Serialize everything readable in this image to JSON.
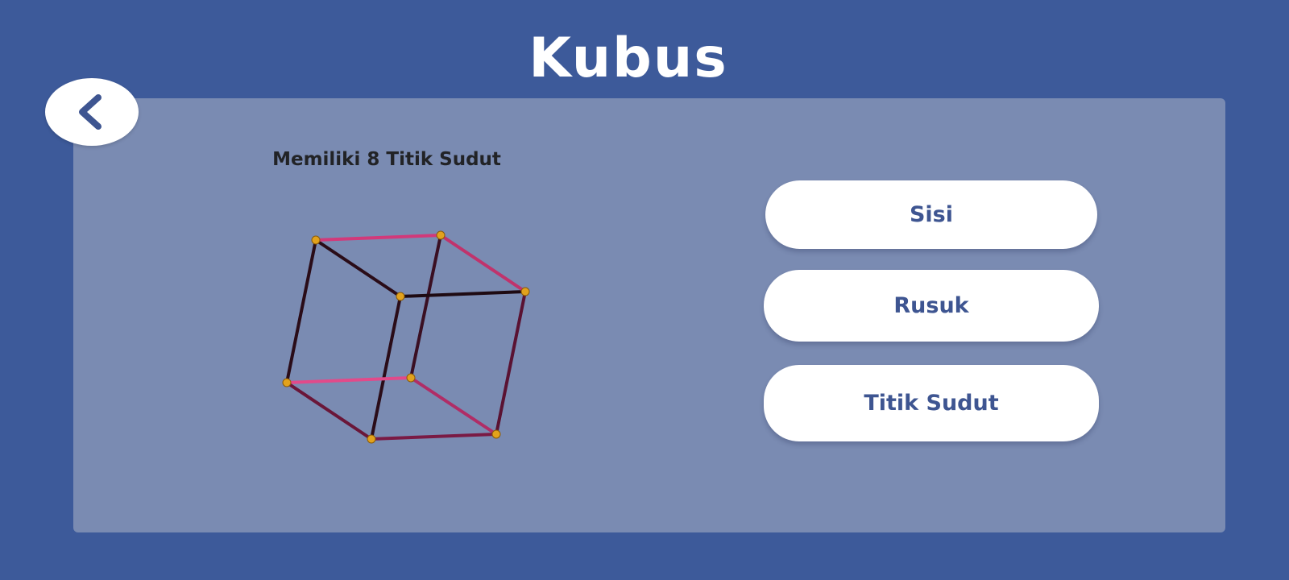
{
  "header": {
    "title": "Kubus"
  },
  "navigation": {
    "back_icon": "chevron-left-icon"
  },
  "content": {
    "caption": "Memiliki 8 Titik Sudut",
    "figure": "cube-wireframe-vertices",
    "vertex_count": 8
  },
  "options": [
    {
      "label": "Sisi"
    },
    {
      "label": "Rusuk"
    },
    {
      "label": "Titik Sudut"
    }
  ],
  "colors": {
    "background": "#3d5a9a",
    "panel": "#7a8bb2",
    "button_text": "#3e5591",
    "edge_dark": "#3a0f22",
    "edge_pink": "#d2397a",
    "vertex": "#e2a21c"
  }
}
